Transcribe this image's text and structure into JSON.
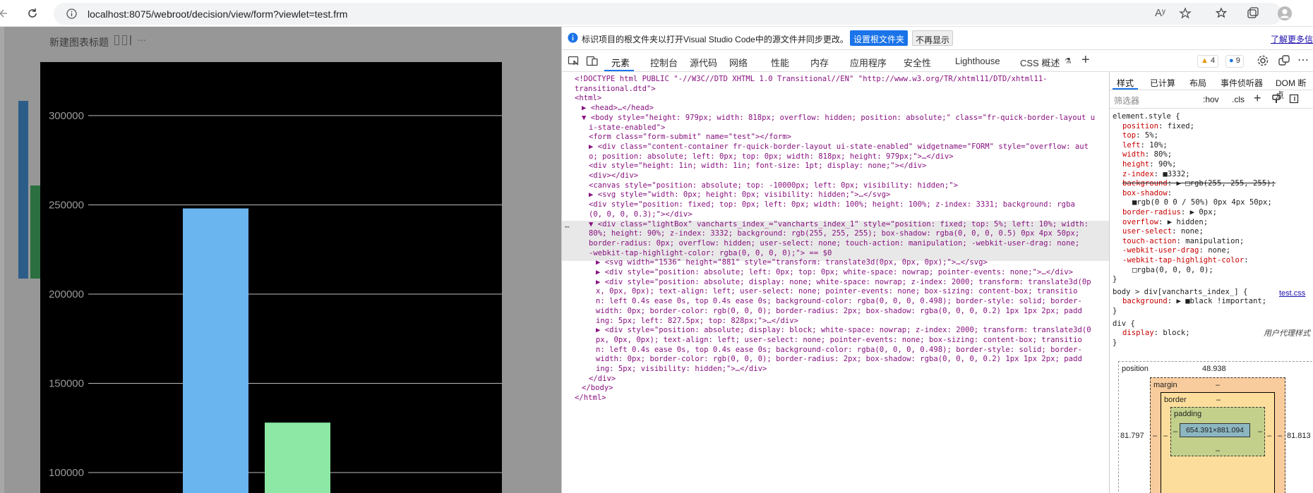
{
  "browser": {
    "url": "localhost:8075/webroot/decision/view/form?viewlet=test.frm",
    "read_aloud": "Aʸ"
  },
  "page": {
    "title": "新建图表标题",
    "chart_data": {
      "type": "bar",
      "ylim": [
        85000,
        330000
      ],
      "yticks": [
        100000,
        150000,
        200000,
        250000,
        300000
      ],
      "ytick_labels": [
        "100000",
        "150000",
        "200000",
        "250000",
        "300000"
      ],
      "grid": true,
      "series": [
        {
          "color": "#6ab4f0",
          "values": [
            248000
          ]
        },
        {
          "color": "#8ce8a4",
          "values": [
            128000
          ]
        }
      ]
    }
  },
  "devtools": {
    "info": {
      "message": "标识项目的根文件夹以打开Visual Studio Code中的源文件并同步更改。",
      "primary_btn": "设置根文件夹",
      "secondary_btn": "不再显示",
      "learn_more": "了解更多信"
    },
    "tabs": [
      "元素",
      "控制台",
      "源代码",
      "网络",
      "性能",
      "内存",
      "应用程序",
      "安全性",
      "Lighthouse",
      "CSS 概述"
    ],
    "warn_count": "4",
    "info_count": "9",
    "styles_tabs": [
      "样式",
      "已计算",
      "布局",
      "事件侦听器",
      "DOM 断点"
    ],
    "filter_placeholder": "筛选器",
    "hov": ":hov",
    "cls": ".cls",
    "code_lines": [
      {
        "indent": 0,
        "html": "<!DOCTYPE html PUBLIC \"-//W3C//DTD XHTML 1.0 Transitional//EN\" \"http://www.w3.org/TR/xhtml11/DTD/xhtml11-"
      },
      {
        "indent": 0,
        "html": "transitional.dtd\">"
      },
      {
        "indent": 0,
        "html": "<html>"
      },
      {
        "indent": 1,
        "html": "▶ <head>…</head>"
      },
      {
        "indent": 1,
        "html": "▼ <body style=\"height: 979px; width: 818px; overflow: hidden; position: absolute;\" class=\"fr-quick-border-layout u"
      },
      {
        "indent": 2,
        "html": "i-state-enabled\">"
      },
      {
        "indent": 2,
        "html": "<form class=\"form-submit\" name=\"test\"></form>"
      },
      {
        "indent": 2,
        "html": "▶ <div class=\"content-container fr-quick-border-layout ui-state-enabled\" widgetname=\"FORM\" style=\"overflow: aut"
      },
      {
        "indent": 2,
        "html": "o; position: absolute; left: 0px; top: 0px; width: 818px; height: 979px;\">…</div>"
      },
      {
        "indent": 2,
        "html": "<div style=\"height: 1in; width: 1in; font-size: 1pt; display: none;\"></div>"
      },
      {
        "indent": 2,
        "html": "<div></div>"
      },
      {
        "indent": 2,
        "html": "<canvas style=\"position: absolute; top: -10000px; left: 0px; visibility: hidden;\">"
      },
      {
        "indent": 2,
        "html": "▶ <svg style=\"width: 0px; height: 0px; visibility: hidden;\">…</svg>"
      },
      {
        "indent": 2,
        "html": "<div style=\"position: fixed; top: 0px; left: 0px; width: 100%; height: 100%; z-index: 3331; background: rgba"
      },
      {
        "indent": 2,
        "html": "(0, 0, 0, 0.3);\"></div>"
      },
      {
        "indent": 2,
        "html": "▼ <div class=\"lightBox\" vancharts_index_=\"vancharts_index_1\" style=\"position: fixed; top: 5%; left: 10%; width:"
      },
      {
        "indent": 2,
        "html": "80%; height: 90%; z-index: 3332; background: rgb(255, 255, 255); box-shadow: rgba(0, 0, 0, 0.5) 0px 4px 50px;"
      },
      {
        "indent": 2,
        "html": "border-radius: 0px; overflow: hidden; user-select: none; touch-action: manipulation; -webkit-user-drag: none;"
      },
      {
        "indent": 2,
        "html": "-webkit-tap-highlight-color: rgba(0, 0, 0, 0);\"> == $0"
      },
      {
        "indent": 3,
        "html": "▶ <svg width=\"1536\" height=\"881\" style=\"transform: translate3d(0px, 0px, 0px);\">…</svg>"
      },
      {
        "indent": 3,
        "html": "▶ <div style=\"position: absolute; left: 0px; top: 0px; white-space: nowrap; pointer-events: none;\">…</div>"
      },
      {
        "indent": 3,
        "html": "▶ <div style=\"position: absolute; display: none; white-space: nowrap; z-index: 2000; transform: translate3d(0p"
      },
      {
        "indent": 3,
        "html": "x, 0px, 0px); text-align: left; user-select: none; pointer-events: none; box-sizing: content-box; transitio"
      },
      {
        "indent": 3,
        "html": "n: left 0.4s ease 0s, top 0.4s ease 0s; background-color: rgba(0, 0, 0, 0.498); border-style: solid; border-"
      },
      {
        "indent": 3,
        "html": "width: 0px; border-color: rgb(0, 0, 0); border-radius: 2px; box-shadow: rgba(0, 0, 0, 0.2) 1px 1px 2px; padd"
      },
      {
        "indent": 3,
        "html": "ing: 5px; left: 827.5px; top: 828px;\">…</div>"
      },
      {
        "indent": 3,
        "html": "▶ <div style=\"position: absolute; display: block; white-space: nowrap; z-index: 2000; transform: translate3d(0"
      },
      {
        "indent": 3,
        "html": "px, 0px, 0px); text-align: left; user-select: none; pointer-events: none; box-sizing: content-box; transitio"
      },
      {
        "indent": 3,
        "html": "n: left 0.4s ease 0s, top 0.4s ease 0s; background-color: rgba(0, 0, 0, 0.498); border-style: solid; border-"
      },
      {
        "indent": 3,
        "html": "width: 0px; border-color: rgb(0, 0, 0); border-radius: 2px; box-shadow: rgba(0, 0, 0, 0.2) 1px 1px 2px; padd"
      },
      {
        "indent": 3,
        "html": "ing: 5px; visibility: hidden;\">…</div>"
      },
      {
        "indent": 2,
        "html": "</div>"
      },
      {
        "indent": 1,
        "html": "</body>"
      },
      {
        "indent": 0,
        "html": "</html>"
      }
    ],
    "styles_lines": [
      {
        "i": 0,
        "t": "element.style {"
      },
      {
        "i": 1,
        "t": "position: fixed;"
      },
      {
        "i": 1,
        "t": "top: 5%;"
      },
      {
        "i": 1,
        "t": "left: 10%;"
      },
      {
        "i": 1,
        "t": "width: 80%;"
      },
      {
        "i": 1,
        "t": "height: 90%;"
      },
      {
        "i": 1,
        "t": "z-index: ■3332;"
      },
      {
        "i": 1,
        "t": "background: ▶ □rgb(255, 255, 255);"
      },
      {
        "i": 1,
        "t": "box-shadow:"
      },
      {
        "i": 2,
        "t": "■rgb(0 0 0 / 50%) 0px 4px 50px;"
      },
      {
        "i": 1,
        "t": "border-radius: ▶ 0px;"
      },
      {
        "i": 1,
        "t": "overflow: ▶ hidden;"
      },
      {
        "i": 1,
        "t": "user-select: none;"
      },
      {
        "i": 1,
        "t": "touch-action: manipulation;"
      },
      {
        "i": 1,
        "t": "-webkit-user-drag: none;"
      },
      {
        "i": 1,
        "t": "-webkit-tap-highlight-color:"
      },
      {
        "i": 2,
        "t": "□rgba(0, 0, 0, 0);"
      },
      {
        "i": 0,
        "t": "}"
      },
      {
        "i": 0,
        "t": "body > div[vancharts_index_] {"
      },
      {
        "i": 1,
        "t": "background: ▶ ■black !important;"
      },
      {
        "i": 0,
        "t": "}"
      },
      {
        "i": 0,
        "t": "div {"
      },
      {
        "i": 1,
        "t": "display: block;"
      },
      {
        "i": 0,
        "t": "}"
      }
    ],
    "test_css_link": "test.css",
    "user_agent_label": "用户代理样式",
    "boxmodel": {
      "position_label": "position",
      "position_top": "48.938",
      "position_left": "81.797",
      "position_right": "81.813",
      "margin_label": "margin",
      "border_label": "border",
      "padding_label": "padding",
      "dash": "–",
      "content": "654.391×881.094"
    }
  }
}
